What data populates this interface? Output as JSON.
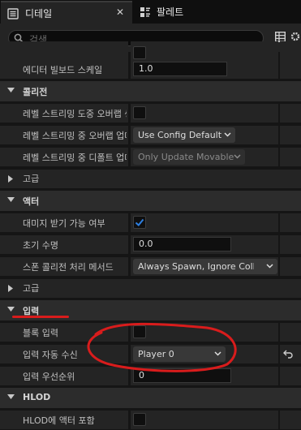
{
  "tabs": [
    {
      "label": "디테일",
      "icon": "details-icon",
      "active": true
    },
    {
      "label": "팔레트",
      "icon": "palette-icon",
      "active": false
    }
  ],
  "close_glyph": "✕",
  "search": {
    "placeholder": "검색"
  },
  "rows": {
    "billboard": {
      "name": "에디터 빌보드 스케일",
      "value": "1.0"
    },
    "collision": {
      "title": "콜리전"
    },
    "level_stream_overlap": {
      "name": "레벨 스트리밍 도중 오버랩 생성"
    },
    "level_stream_update_overlap": {
      "name": "레벨 스트리밍 중 오버랩 업데이트 메서드",
      "value": "Use Config Default"
    },
    "level_stream_default_update": {
      "name": "레벨 스트리밍 중 디폴트 업데이트 메서드",
      "value": "Only Update Movable"
    },
    "advanced1": {
      "title": "고급"
    },
    "actor": {
      "title": "액터"
    },
    "can_be_damaged": {
      "name": "대미지 받기 가능 여부",
      "checked": true
    },
    "initial_life_span": {
      "name": "초기 수명",
      "value": "0.0"
    },
    "spawn_collision": {
      "name": "스폰 콜리전 처리 메서드",
      "value": "Always Spawn, Ignore Collisions"
    },
    "advanced2": {
      "title": "고급"
    },
    "input": {
      "title": "입력"
    },
    "block_input": {
      "name": "블록 입력",
      "checked": false
    },
    "auto_receive_input": {
      "name": "입력 자동 수신",
      "value": "Player 0"
    },
    "input_priority": {
      "name": "입력 우선순위",
      "value": "0"
    },
    "hlod": {
      "title": "HLOD"
    },
    "hlod_include": {
      "name": "HLOD에 액터 포함"
    }
  },
  "colors": {
    "accent_check": "#2d7fe0",
    "annotation_red": "#d91c1c"
  }
}
